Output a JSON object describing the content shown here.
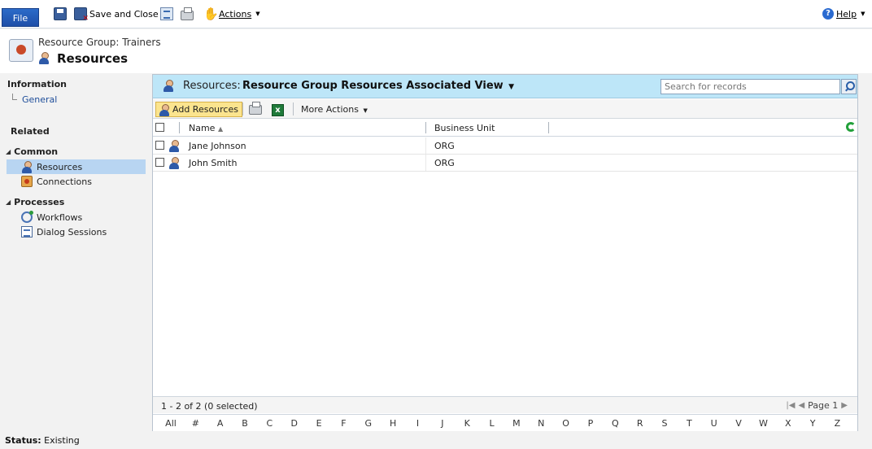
{
  "ribbon": {
    "file": "File",
    "save_close": "Save and Close",
    "actions": "Actions",
    "help": "Help"
  },
  "header": {
    "subtitle": "Resource Group: Trainers",
    "title": "Resources"
  },
  "nav": {
    "information": "Information",
    "general": "General",
    "related": "Related",
    "common": "Common",
    "resources": "Resources",
    "connections": "Connections",
    "processes": "Processes",
    "workflows": "Workflows",
    "dialog_sessions": "Dialog Sessions"
  },
  "view": {
    "label": "Resources:",
    "name": "Resource Group Resources Associated View",
    "search_placeholder": "Search for records"
  },
  "toolbar": {
    "add_resources": "Add Resources",
    "more_actions": "More Actions"
  },
  "grid": {
    "columns": [
      "Name",
      "Business Unit"
    ],
    "rows": [
      {
        "name": "Jane Johnson",
        "business_unit": "ORG"
      },
      {
        "name": "John Smith",
        "business_unit": "ORG"
      }
    ],
    "record_count": "1 - 2 of 2 (0 selected)",
    "page": "Page 1"
  },
  "alpha_index": [
    "All",
    "#",
    "A",
    "B",
    "C",
    "D",
    "E",
    "F",
    "G",
    "H",
    "I",
    "J",
    "K",
    "L",
    "M",
    "N",
    "O",
    "P",
    "Q",
    "R",
    "S",
    "T",
    "U",
    "V",
    "W",
    "X",
    "Y",
    "Z"
  ],
  "status": {
    "label": "Status:",
    "value": "Existing"
  }
}
